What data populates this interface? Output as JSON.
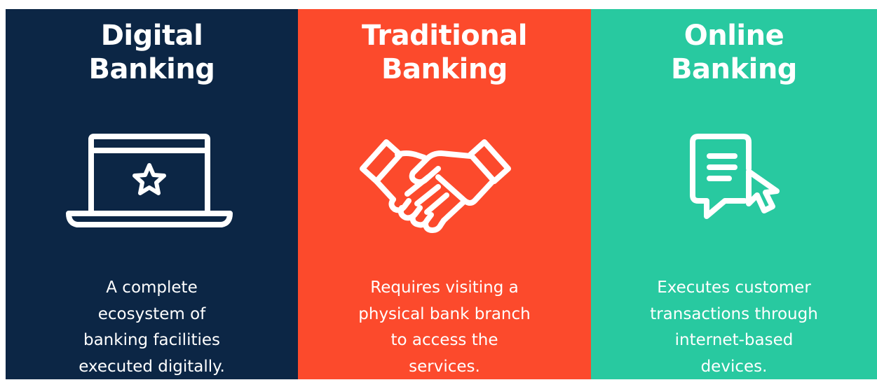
{
  "panels": [
    {
      "title_lines": [
        "Digital",
        "Banking"
      ],
      "icon": "laptop-star-icon",
      "description_lines": [
        "A complete",
        "ecosystem of",
        "banking facilities",
        "executed digitally."
      ],
      "color": "#0c2645"
    },
    {
      "title_lines": [
        "Traditional",
        "Banking"
      ],
      "icon": "handshake-icon",
      "description_lines": [
        "Requires visiting a",
        "physical bank branch",
        "to access the",
        "services."
      ],
      "color": "#fc4a2c"
    },
    {
      "title_lines": [
        "Online",
        "Banking"
      ],
      "icon": "chat-bubble-cursor-icon",
      "description_lines": [
        "Executes customer",
        "transactions through",
        "internet-based",
        "devices."
      ],
      "color": "#28c9a0"
    }
  ],
  "colors": {
    "text": "#ffffff"
  }
}
